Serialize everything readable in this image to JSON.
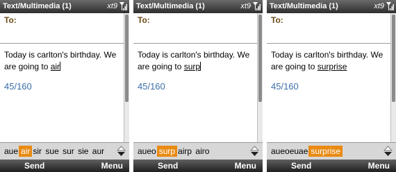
{
  "screens": [
    {
      "title": "Text/Multimedia (1)",
      "input_mode": "xt9",
      "to_label": "To:",
      "message_prefix": "Today is carlton's birthday. We are going to ",
      "message_word": "air",
      "char_count": "45/160",
      "candidates": [
        "aue",
        "air",
        "sir",
        "sue",
        "sur",
        "sie",
        "aur"
      ],
      "selected_candidate": 1,
      "softkey_left": "Send",
      "softkey_right": "Menu"
    },
    {
      "title": "Text/Multimedia (1)",
      "input_mode": "xt9",
      "to_label": "To:",
      "message_prefix": "Today is carlton's birthday. We are going to ",
      "message_word": "surp",
      "char_count": "45/160",
      "candidates": [
        "aueo",
        "surp",
        "airp",
        "airo"
      ],
      "selected_candidate": 1,
      "softkey_left": "Send",
      "softkey_right": "Menu"
    },
    {
      "title": "Text/Multimedia (1)",
      "input_mode": "xt9",
      "to_label": "To:",
      "message_prefix": "Today is carlton's birthday. We are going to ",
      "message_word": "surprise",
      "char_count": "45/160",
      "candidates": [
        "aueoeuae",
        "surprise"
      ],
      "selected_candidate": 1,
      "softkey_left": "Send",
      "softkey_right": "Menu"
    }
  ],
  "colors": {
    "title_bar": "#3c3c3c",
    "to_label": "#6b4a14",
    "counter": "#3a6ea8",
    "candidate_highlight": "#e98a12"
  },
  "icons": {
    "signal": "signal-strength-icon",
    "scroll": "up-down-arrows-icon"
  }
}
